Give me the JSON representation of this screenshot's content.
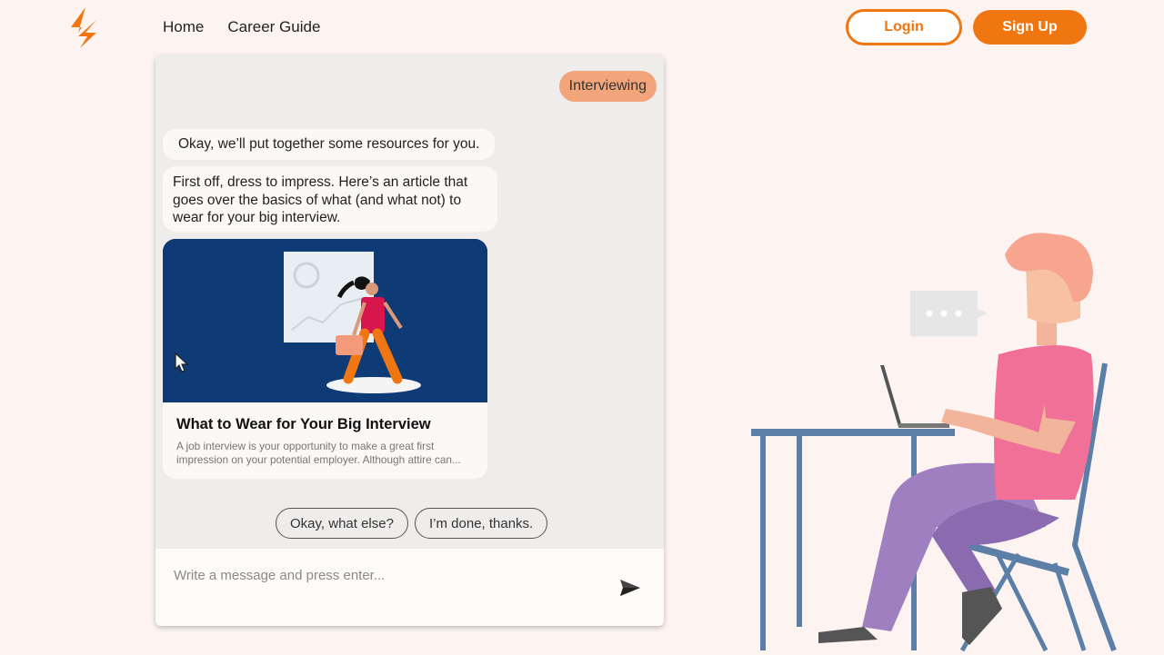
{
  "header": {
    "logo_icon": "lightning-bolt-icon",
    "nav": [
      {
        "label": "Home"
      },
      {
        "label": "Career Guide"
      }
    ],
    "login_label": "Login",
    "signup_label": "Sign Up",
    "accent_color": "#f07612"
  },
  "chat": {
    "user_message": "Interviewing",
    "bot_messages": [
      "Okay, we’ll put together some resources for you.",
      "First off, dress to impress. Here’s an article that goes over the basics of what (and what not) to wear for your big interview."
    ],
    "article": {
      "title": "What to Wear for Your Big Interview",
      "description": "A job interview is your opportunity to make a great first impression on your potential employer. Although attire can..."
    },
    "quick_replies": [
      {
        "label": "Okay, what else?"
      },
      {
        "label": "I’m done, thanks."
      }
    ],
    "input_placeholder": "Write a message and press enter...",
    "send_icon": "send-icon"
  }
}
